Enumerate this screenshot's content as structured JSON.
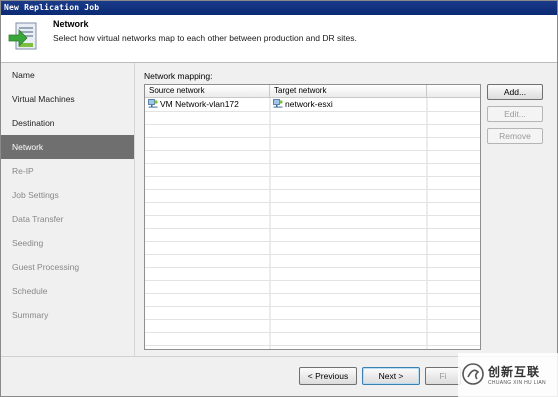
{
  "window": {
    "title": "New Replication Job"
  },
  "header": {
    "title": "Network",
    "subtitle": "Select how virtual networks map to each other between production and DR sites.",
    "icon": "network-wizard-icon"
  },
  "sidebar": {
    "items": [
      {
        "label": "Name",
        "state": "done"
      },
      {
        "label": "Virtual Machines",
        "state": "done"
      },
      {
        "label": "Destination",
        "state": "done"
      },
      {
        "label": "Network",
        "state": "active"
      },
      {
        "label": "Re-IP",
        "state": "disabled"
      },
      {
        "label": "Job Settings",
        "state": "disabled"
      },
      {
        "label": "Data Transfer",
        "state": "disabled"
      },
      {
        "label": "Seeding",
        "state": "disabled"
      },
      {
        "label": "Guest Processing",
        "state": "disabled"
      },
      {
        "label": "Schedule",
        "state": "disabled"
      },
      {
        "label": "Summary",
        "state": "disabled"
      }
    ]
  },
  "mapping": {
    "label": "Network mapping:",
    "columns": [
      "Source network",
      "Target network",
      ""
    ],
    "rows": [
      {
        "source": "VM Network-vlan172",
        "target": "network-esxi"
      }
    ]
  },
  "side_buttons": {
    "add": "Add...",
    "edit": "Edit...",
    "remove": "Remove"
  },
  "footer": {
    "previous": "< Previous",
    "next": "Next >",
    "finish": "Fi"
  },
  "watermark": {
    "text": "创新互联",
    "sub": "CHUANG XIN HU LIAN"
  },
  "colors": {
    "titlebar": "#0a2a74",
    "active_item": "#6f6f6f",
    "icon_green": "#3aa63a"
  }
}
